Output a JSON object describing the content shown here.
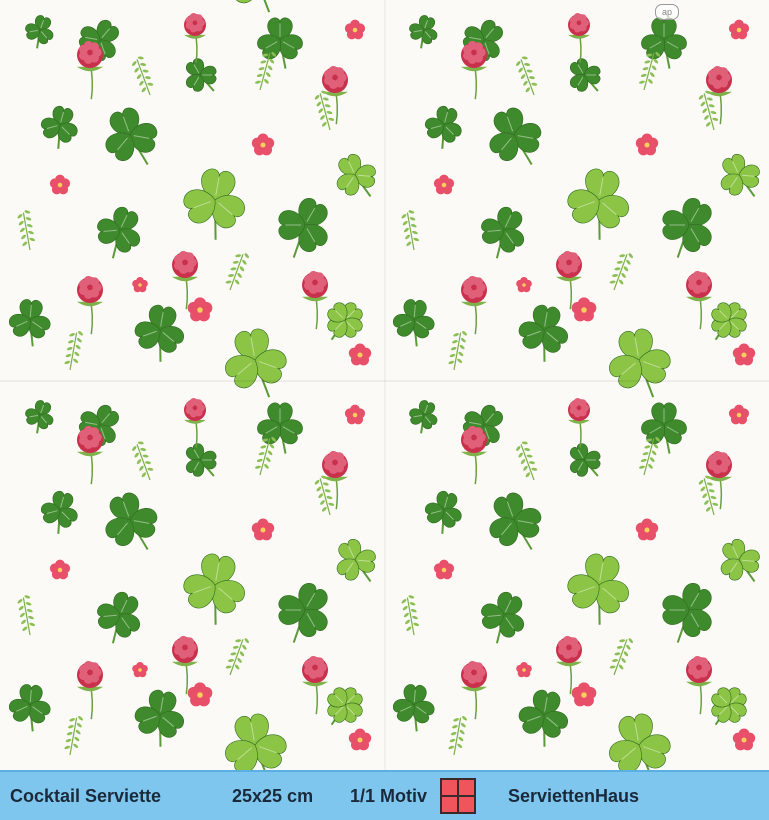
{
  "napkin": {
    "watermark": "ap",
    "colors": {
      "leaf_dark": "#3f8a2c",
      "leaf_light": "#8cc445",
      "clover_flower": "#c9304c",
      "small_flower": "#e8506a",
      "background": "#fbfaf6"
    }
  },
  "footer": {
    "product": "Cocktail Serviette",
    "size": "25x25 cm",
    "motif": "1/1 Motiv",
    "brand": "ServiettenHaus",
    "bar_color": "#7fc6ef",
    "icon_color": "#f0555d",
    "icon": "quad-square-icon"
  }
}
